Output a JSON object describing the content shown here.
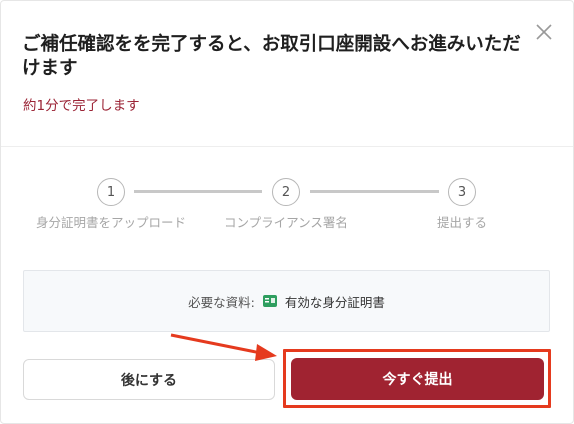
{
  "dialog": {
    "title": "ご補任確認をを完了すると、お取引口座開設へお進みいただけます",
    "subtitle": "約1分で完了します",
    "close_icon": "close-icon"
  },
  "steps": [
    {
      "number": "1",
      "label": "身分証明書をアップロード"
    },
    {
      "number": "2",
      "label": "コンプライアンス署名"
    },
    {
      "number": "3",
      "label": "提出する"
    }
  ],
  "requirements": {
    "label": "必要な資料:",
    "icon": "id-card-icon",
    "value": "有効な身分証明書",
    "icon_color": "#2e9e5f"
  },
  "buttons": {
    "later": "後にする",
    "submit": "今すぐ提出"
  },
  "colors": {
    "accent": "#a02331",
    "annotation": "#e53a1e"
  }
}
